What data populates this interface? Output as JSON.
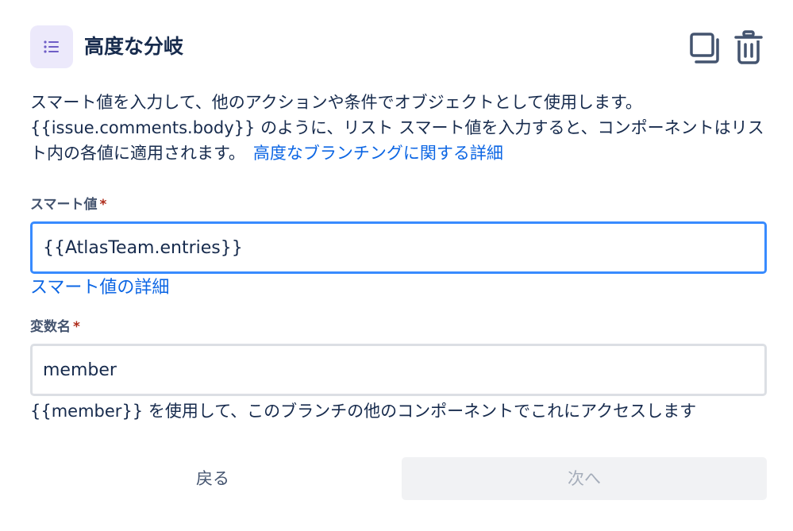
{
  "header": {
    "title": "高度な分岐",
    "icon": "list-icon",
    "accent_tile_color": "#ece9fb",
    "icon_color": "#6e5dc6",
    "actions": {
      "duplicate_icon": "duplicate-icon",
      "delete_icon": "trash-icon"
    }
  },
  "description": {
    "text": "スマート値を入力して、他のアクションや条件でオブジェクトとして使用します。{{issue.comments.body}} のように、リスト スマート値を入力すると、コンポーネントはリスト内の各値に適用されます。",
    "link": "高度なブランチングに関する詳細"
  },
  "smart_value": {
    "label": "スマート値",
    "required_mark": "*",
    "value": "{{AtlasTeam.entries}}",
    "help_link": "スマート値の詳細"
  },
  "variable_name": {
    "label": "変数名",
    "required_mark": "*",
    "value": "member",
    "helper": "{{member}} を使用して、このブランチの他のコンポーネントでこれにアクセスします"
  },
  "footer": {
    "back_label": "戻る",
    "next_label": "次へ"
  },
  "colors": {
    "link": "#0c66e4",
    "focus_border": "#388bff",
    "required": "#ae2a19",
    "text": "#172b4d"
  }
}
